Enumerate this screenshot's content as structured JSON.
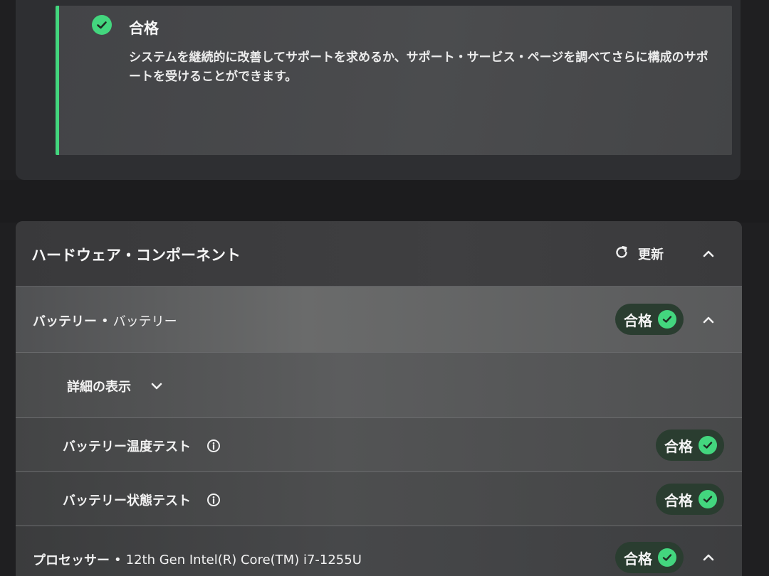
{
  "result": {
    "title": "合格",
    "message": "システムを継続的に改善してサポートを求めるか、サポート・サービス・ページを調べてさらに構成のサポートを受けることができます。",
    "check_icon": "check-circle-icon"
  },
  "hardware": {
    "title": "ハードウェア・コンポーネント",
    "refresh_label": "更新",
    "refresh_icon": "refresh-icon",
    "collapse_icon": "chevron-up-icon",
    "rows": {
      "battery": {
        "category": "バッテリー",
        "separator": "•",
        "name": "バッテリー",
        "status": "合格"
      },
      "details": {
        "label": "詳細の表示",
        "expand_icon": "chevron-down-icon"
      },
      "temp_test": {
        "label": "バッテリー温度テスト",
        "status": "合格",
        "info_icon": "info-icon"
      },
      "state_test": {
        "label": "バッテリー状態テスト",
        "status": "合格",
        "info_icon": "info-icon"
      },
      "processor": {
        "category": "プロセッサー",
        "separator": "•",
        "name": "12th Gen Intel(R) Core(TM) i7-1255U",
        "status": "合格"
      }
    }
  },
  "colors": {
    "accent_green": "#43d67e",
    "pill_bg": "#2a3d30",
    "panel_bg": "#3b3c3e",
    "page_bg": "#1f1f21"
  }
}
